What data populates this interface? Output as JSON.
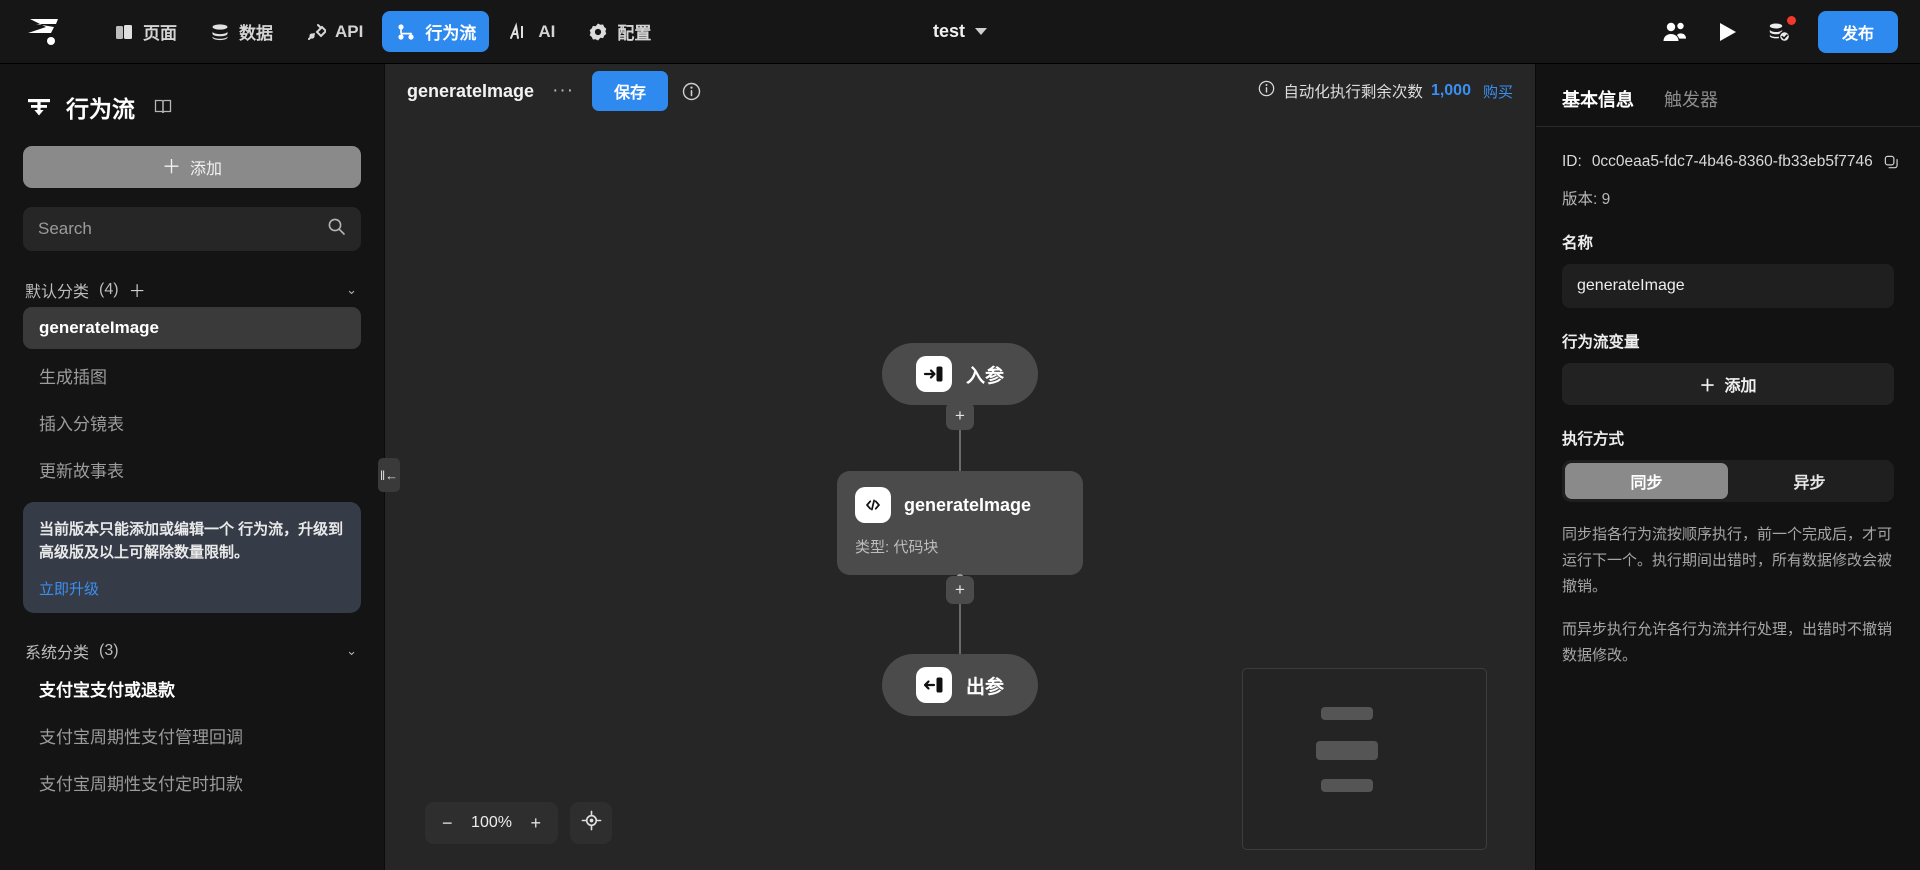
{
  "topbar": {
    "logo": "zhiyun-logo",
    "nav": [
      {
        "label": "页面",
        "icon": "pages-icon",
        "active": false
      },
      {
        "label": "数据",
        "icon": "database-icon",
        "active": false
      },
      {
        "label": "API",
        "icon": "api-plug-icon",
        "active": false
      },
      {
        "label": "行为流",
        "icon": "workflow-icon",
        "active": true
      },
      {
        "label": "AI",
        "icon": "ai-icon",
        "active": false
      },
      {
        "label": "配置",
        "icon": "gear-icon",
        "active": false
      }
    ],
    "project_title": "test",
    "actions": [
      {
        "name": "members-icon",
        "label": "成员"
      },
      {
        "name": "preview-play-icon",
        "label": "预览"
      },
      {
        "name": "version-check-icon",
        "label": "版本",
        "badge": true
      }
    ],
    "publish_label": "发布"
  },
  "sidebar": {
    "title": "行为流",
    "book_icon": "book-icon",
    "add_label": "添加",
    "search_placeholder": "Search",
    "search_value": "",
    "groups": [
      {
        "name": "默认分类",
        "count": "(4)",
        "items": [
          {
            "label": "generateImage",
            "selected": true
          },
          {
            "label": "生成插图",
            "selected": false
          },
          {
            "label": "插入分镜表",
            "selected": false
          },
          {
            "label": "更新故事表",
            "selected": false
          }
        ]
      },
      {
        "name": "系统分类",
        "count": "(3)",
        "items": [
          {
            "label": "支付宝支付或退款",
            "selected": false,
            "highlight": true
          },
          {
            "label": "支付宝周期性支付管理回调",
            "selected": false
          },
          {
            "label": "支付宝周期性支付定时扣款",
            "selected": false
          }
        ]
      }
    ],
    "notice": {
      "text": "当前版本只能添加或编辑一个 行为流，升级到高级版及以上可解除数量限制。",
      "link": "立即升级"
    },
    "collapse_label": "‖←"
  },
  "canvas": {
    "flow_name": "generateImage",
    "more_label": "···",
    "save_label": "保存",
    "info_icon": "info-icon",
    "quota": {
      "icon": "info-icon",
      "label": "自动化执行剩余次数",
      "value": "1,000",
      "buy_label": "购买"
    },
    "nodes": [
      {
        "type": "pill",
        "icon": "input-param-icon",
        "label": "入参"
      },
      {
        "type": "card",
        "icon": "code-block-icon",
        "title": "generateImage",
        "subtitle": "类型: 代码块"
      },
      {
        "type": "pill",
        "icon": "output-param-icon",
        "label": "出参"
      }
    ],
    "add_node_label": "+",
    "zoom": {
      "minus": "−",
      "value": "100%",
      "plus": "+",
      "fit_icon": "fit-view-icon"
    },
    "minimap": "minimap"
  },
  "right_panel": {
    "tabs": [
      {
        "label": "基本信息",
        "active": true
      },
      {
        "label": "触发器",
        "active": false
      }
    ],
    "id_label": "ID:",
    "id_value": "0cc0eaa5-fdc7-4b46-8360-fb33eb5f7746",
    "copy_icon": "copy-icon",
    "version_label": "版本: 9",
    "name_label": "名称",
    "name_value": "generateImage",
    "variables_label": "行为流变量",
    "variables_add_label": "添加",
    "exec_label": "执行方式",
    "exec_options": [
      {
        "label": "同步",
        "active": true
      },
      {
        "label": "异步",
        "active": false
      }
    ],
    "desc_1": "同步指各行为流按顺序执行，前一个完成后，才可运行下一个。执行期间出错时，所有数据修改会被撤销。",
    "desc_2": "而异步执行允许各行为流并行处理，出错时不撤销数据修改。"
  },
  "colors": {
    "accent": "#2f8aef",
    "link": "#3b8ff0",
    "badge": "#f0392b"
  }
}
